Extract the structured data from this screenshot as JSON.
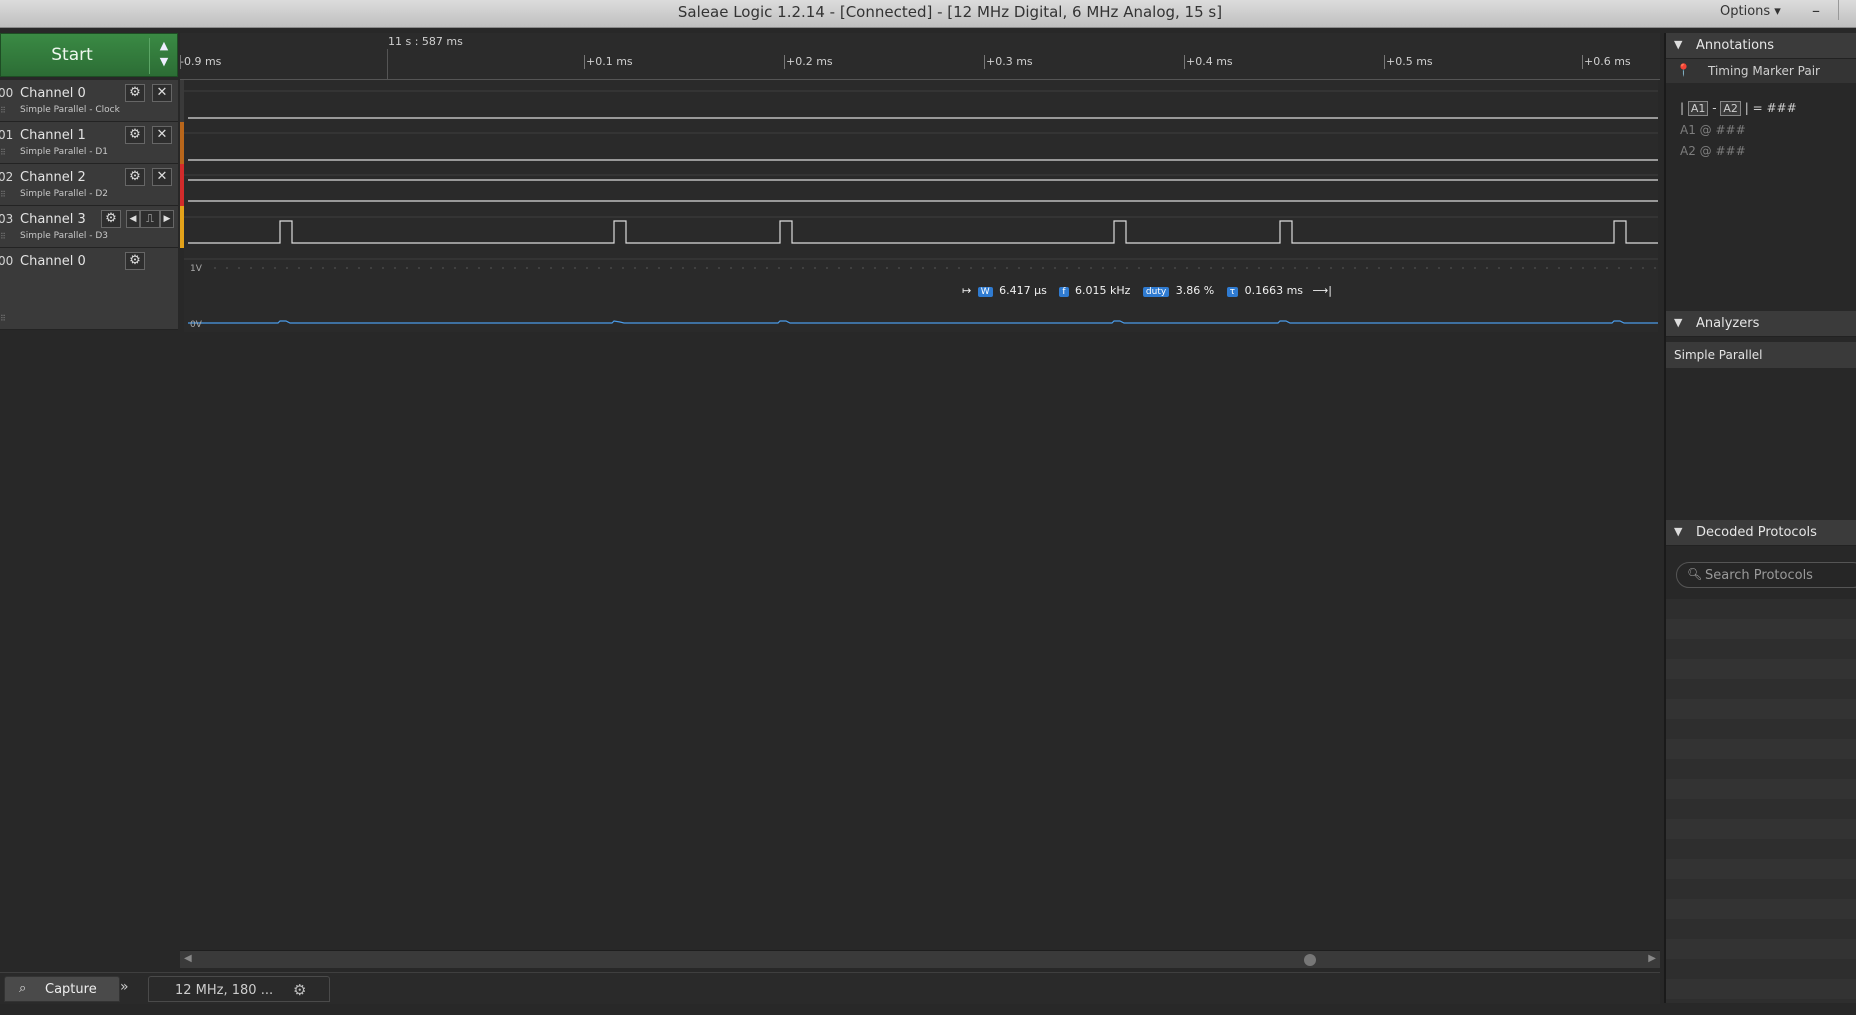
{
  "window": {
    "title": "Saleae Logic 1.2.14 - [Connected] - [12 MHz Digital, 6 MHz Analog, 15 s]",
    "options_label": "Options ▾",
    "minimize_label": "–"
  },
  "start_button": {
    "label": "Start"
  },
  "timeline": {
    "absolute_time": "11 s : 587 ms",
    "ticks": [
      {
        "label": "-0.9 ms"
      },
      {
        "label": "+0.1 ms"
      },
      {
        "label": "+0.2 ms"
      },
      {
        "label": "+0.3 ms"
      },
      {
        "label": "+0.4 ms"
      },
      {
        "label": "+0.5 ms"
      },
      {
        "label": "+0.6 ms"
      }
    ]
  },
  "channels": [
    {
      "index": "00",
      "name": "Channel 0",
      "subtitle": "Simple Parallel - Clock",
      "color": "#3a3a3a"
    },
    {
      "index": "01",
      "name": "Channel 1",
      "subtitle": "Simple Parallel - D1",
      "color": "#b8661b"
    },
    {
      "index": "02",
      "name": "Channel 2",
      "subtitle": "Simple Parallel - D2",
      "color": "#d12b2b"
    },
    {
      "index": "03",
      "name": "Channel 3",
      "subtitle": "Simple Parallel - D3",
      "color": "#e3a21a"
    },
    {
      "index": "00",
      "name": "Channel 0",
      "subtitle": "",
      "color": "#3a3a3a"
    }
  ],
  "analog_labels": {
    "top": "1V",
    "bottom": "0V"
  },
  "measurement": {
    "width_tag": "W",
    "width": "6.417 µs",
    "freq_tag": "f",
    "freq": "6.015 kHz",
    "duty_tag": "duty",
    "duty": "3.86 %",
    "period_tag": "τ",
    "period": "0.1663 ms"
  },
  "bottom": {
    "capture_label": "Capture",
    "session_label": "12 MHz, 180 ..."
  },
  "right_panel": {
    "annotations_title": "Annotations",
    "timing_marker_pair": "Timing Marker Pair",
    "a1": "A1",
    "a2": "A2",
    "dash": "-",
    "equals_value": "= ###",
    "a1_row": "A1  @  ###",
    "a2_row": "A2  @  ###",
    "analyzers_title": "Analyzers",
    "analyzer_item": "Simple Parallel",
    "decoded_title": "Decoded Protocols",
    "search_placeholder": "Search Protocols"
  },
  "colors": {
    "accent_green": "#2f7a3a",
    "measure_blue": "#2f7bd1",
    "analog_trace": "#4a9be8"
  }
}
